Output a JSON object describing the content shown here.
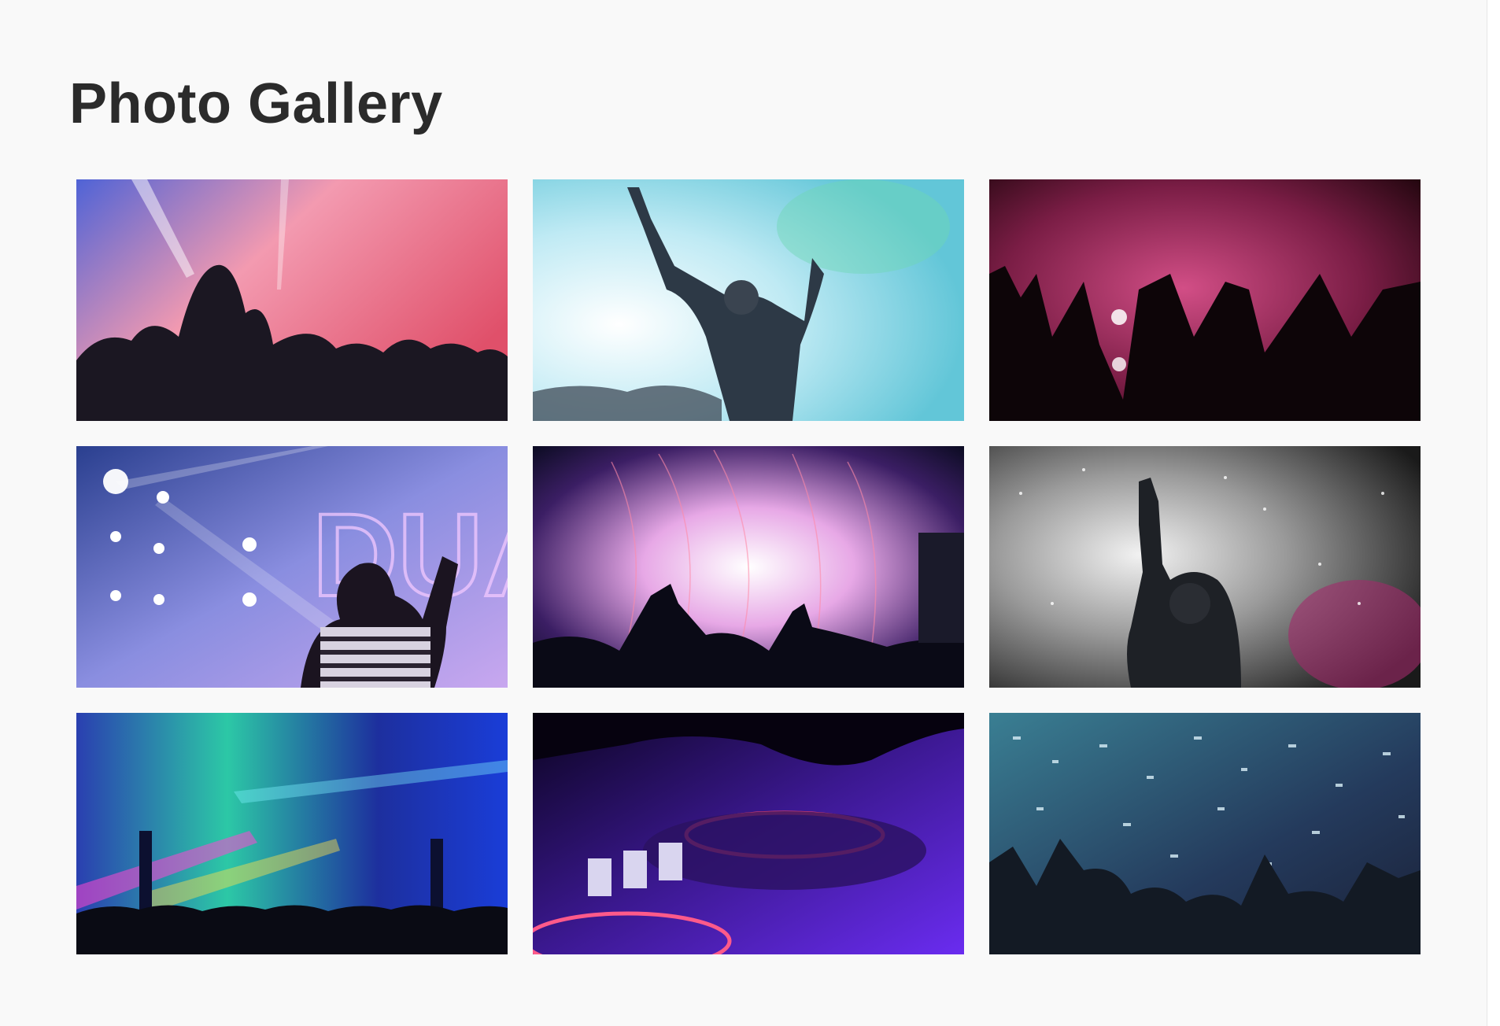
{
  "page": {
    "title": "Photo Gallery"
  },
  "gallery": {
    "photos": [
      {
        "subject": "crowd-hands-pink-smoke",
        "colors": [
          "#5c6fd8",
          "#f28aa0",
          "#1a1a2a"
        ]
      },
      {
        "subject": "woman-dancing-cyan-smoke",
        "colors": [
          "#cfeff7",
          "#7fd6e6",
          "#2a3340"
        ]
      },
      {
        "subject": "raised-hands-magenta-stage",
        "colors": [
          "#3a0f22",
          "#c2427a",
          "#0b0609"
        ]
      },
      {
        "subject": "woman-waving-stage-lights",
        "colors": [
          "#2d3f8a",
          "#b9a4e8",
          "#121429"
        ]
      },
      {
        "subject": "confetti-burst-concert",
        "colors": [
          "#101030",
          "#e7a8e6",
          "#0a0a16"
        ]
      },
      {
        "subject": "singer-smoke-spotlight",
        "colors": [
          "#1a1a1a",
          "#d8d8d8",
          "#9a2a6a"
        ]
      },
      {
        "subject": "festival-laser-crowd",
        "colors": [
          "#1d2f9e",
          "#33d1b0",
          "#0a0b14"
        ]
      },
      {
        "subject": "dj-turntable-neon",
        "colors": [
          "#120630",
          "#6a2cf0",
          "#ff4a6e"
        ]
      },
      {
        "subject": "confetti-crowd-blue",
        "colors": [
          "#1f3550",
          "#6aa6c0",
          "#131a24"
        ]
      }
    ]
  }
}
